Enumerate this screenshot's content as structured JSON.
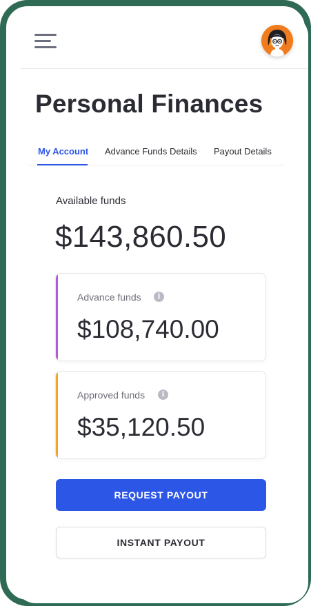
{
  "header": {
    "menu_icon": "hamburger-menu-icon",
    "avatar_icon": "user-avatar"
  },
  "page": {
    "title": "Personal Finances"
  },
  "tabs": [
    {
      "label": "My Account",
      "active": true
    },
    {
      "label": "Advance Funds Details",
      "active": false
    },
    {
      "label": "Payout Details",
      "active": false
    }
  ],
  "available": {
    "label": "Available funds",
    "amount": "$143,860.50"
  },
  "cards": {
    "advance": {
      "label": "Advance funds",
      "amount": "$108,740.00",
      "accent": "#b45ad8",
      "info_icon": "info-icon"
    },
    "approved": {
      "label": "Approved funds",
      "amount": "$35,120.50",
      "accent": "#f2a52b",
      "info_icon": "info-icon"
    }
  },
  "buttons": {
    "request_payout": "REQUEST PAYOUT",
    "instant_payout": "INSTANT PAYOUT"
  },
  "colors": {
    "frame": "#2f6b54",
    "primary": "#2c56e6",
    "avatar_bg": "#f07c1d"
  }
}
